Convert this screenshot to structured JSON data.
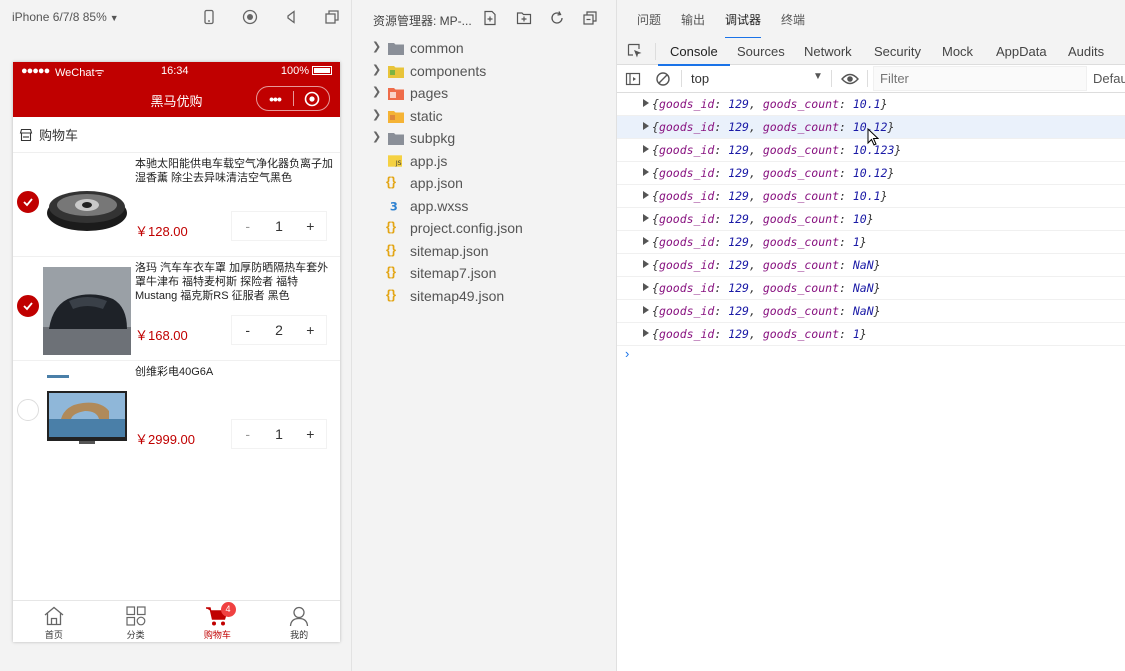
{
  "simulator": {
    "device_label": "iPhone 6/7/8 85%",
    "status_bar": {
      "signal": "●●●●●",
      "carrier": "WeChat",
      "wifi": "ᯤ",
      "time": "16:34",
      "battery": "100%"
    },
    "nav_title": "黑马优购",
    "capsule_dots": "•••",
    "cart_header": "购物车",
    "items": [
      {
        "name": "本驰太阳能供电车载空气净化器负离子加湿香薰 除尘去异味清洁空气黑色",
        "price": "￥128.00",
        "count": "1",
        "checked": true,
        "minus": "-",
        "plus": "+"
      },
      {
        "name": "洛玛 汽车车衣车罩 加厚防晒隔热车套外罩牛津布 福特麦柯斯 探险者 福特Mustang 福克斯RS 征服者 黑色",
        "price": "￥168.00",
        "count": "2",
        "checked": true,
        "minus": "-",
        "plus": "+"
      },
      {
        "name": "创维彩电40G6A",
        "price": "￥2999.00",
        "count": "1",
        "checked": false,
        "minus": "-",
        "plus": "+"
      }
    ],
    "tabbar": [
      {
        "label": "首页",
        "icon": "home-icon"
      },
      {
        "label": "分类",
        "icon": "category-icon"
      },
      {
        "label": "购物车",
        "icon": "cart-icon",
        "badge": "4"
      },
      {
        "label": "我的",
        "icon": "user-icon"
      }
    ],
    "accent_color": "#c00000"
  },
  "explorer": {
    "title": "资源管理器: MP-...",
    "tree": [
      {
        "label": "common",
        "type": "folder",
        "icon": "folder-icon"
      },
      {
        "label": "components",
        "type": "folder",
        "icon": "components-folder-icon"
      },
      {
        "label": "pages",
        "type": "folder",
        "icon": "pages-folder-icon"
      },
      {
        "label": "static",
        "type": "folder",
        "icon": "static-folder-icon"
      },
      {
        "label": "subpkg",
        "type": "folder",
        "icon": "folder-icon"
      },
      {
        "label": "app.js",
        "type": "file",
        "icon": "js-file-icon"
      },
      {
        "label": "app.json",
        "type": "file",
        "icon": "json-file-icon"
      },
      {
        "label": "app.wxss",
        "type": "file",
        "icon": "css-file-icon"
      },
      {
        "label": "project.config.json",
        "type": "file",
        "icon": "json-file-icon"
      },
      {
        "label": "sitemap.json",
        "type": "file",
        "icon": "json-file-icon"
      },
      {
        "label": "sitemap7.json",
        "type": "file",
        "icon": "json-file-icon"
      },
      {
        "label": "sitemap49.json",
        "type": "file",
        "icon": "json-file-icon"
      }
    ]
  },
  "devtools": {
    "top_tabs": [
      "问题",
      "输出",
      "调试器",
      "终端"
    ],
    "active_top_tab": "调试器",
    "panels": [
      "Console",
      "Sources",
      "Network",
      "Security",
      "Mock",
      "AppData",
      "Audits"
    ],
    "active_panel": "Console",
    "context": "top",
    "filter_placeholder": "Filter",
    "levels": "Defau",
    "logs": [
      {
        "key1": "goods_id",
        "v1": "129",
        "key2": "goods_count",
        "v2": "10.1"
      },
      {
        "key1": "goods_id",
        "v1": "129",
        "key2": "goods_count",
        "v2": "10.12",
        "highlight": true
      },
      {
        "key1": "goods_id",
        "v1": "129",
        "key2": "goods_count",
        "v2": "10.123"
      },
      {
        "key1": "goods_id",
        "v1": "129",
        "key2": "goods_count",
        "v2": "10.12"
      },
      {
        "key1": "goods_id",
        "v1": "129",
        "key2": "goods_count",
        "v2": "10.1"
      },
      {
        "key1": "goods_id",
        "v1": "129",
        "key2": "goods_count",
        "v2": "10"
      },
      {
        "key1": "goods_id",
        "v1": "129",
        "key2": "goods_count",
        "v2": "1"
      },
      {
        "key1": "goods_id",
        "v1": "129",
        "key2": "goods_count",
        "v2": "NaN"
      },
      {
        "key1": "goods_id",
        "v1": "129",
        "key2": "goods_count",
        "v2": "NaN"
      },
      {
        "key1": "goods_id",
        "v1": "129",
        "key2": "goods_count",
        "v2": "NaN"
      },
      {
        "key1": "goods_id",
        "v1": "129",
        "key2": "goods_count",
        "v2": "1"
      }
    ],
    "prompt": "›"
  }
}
